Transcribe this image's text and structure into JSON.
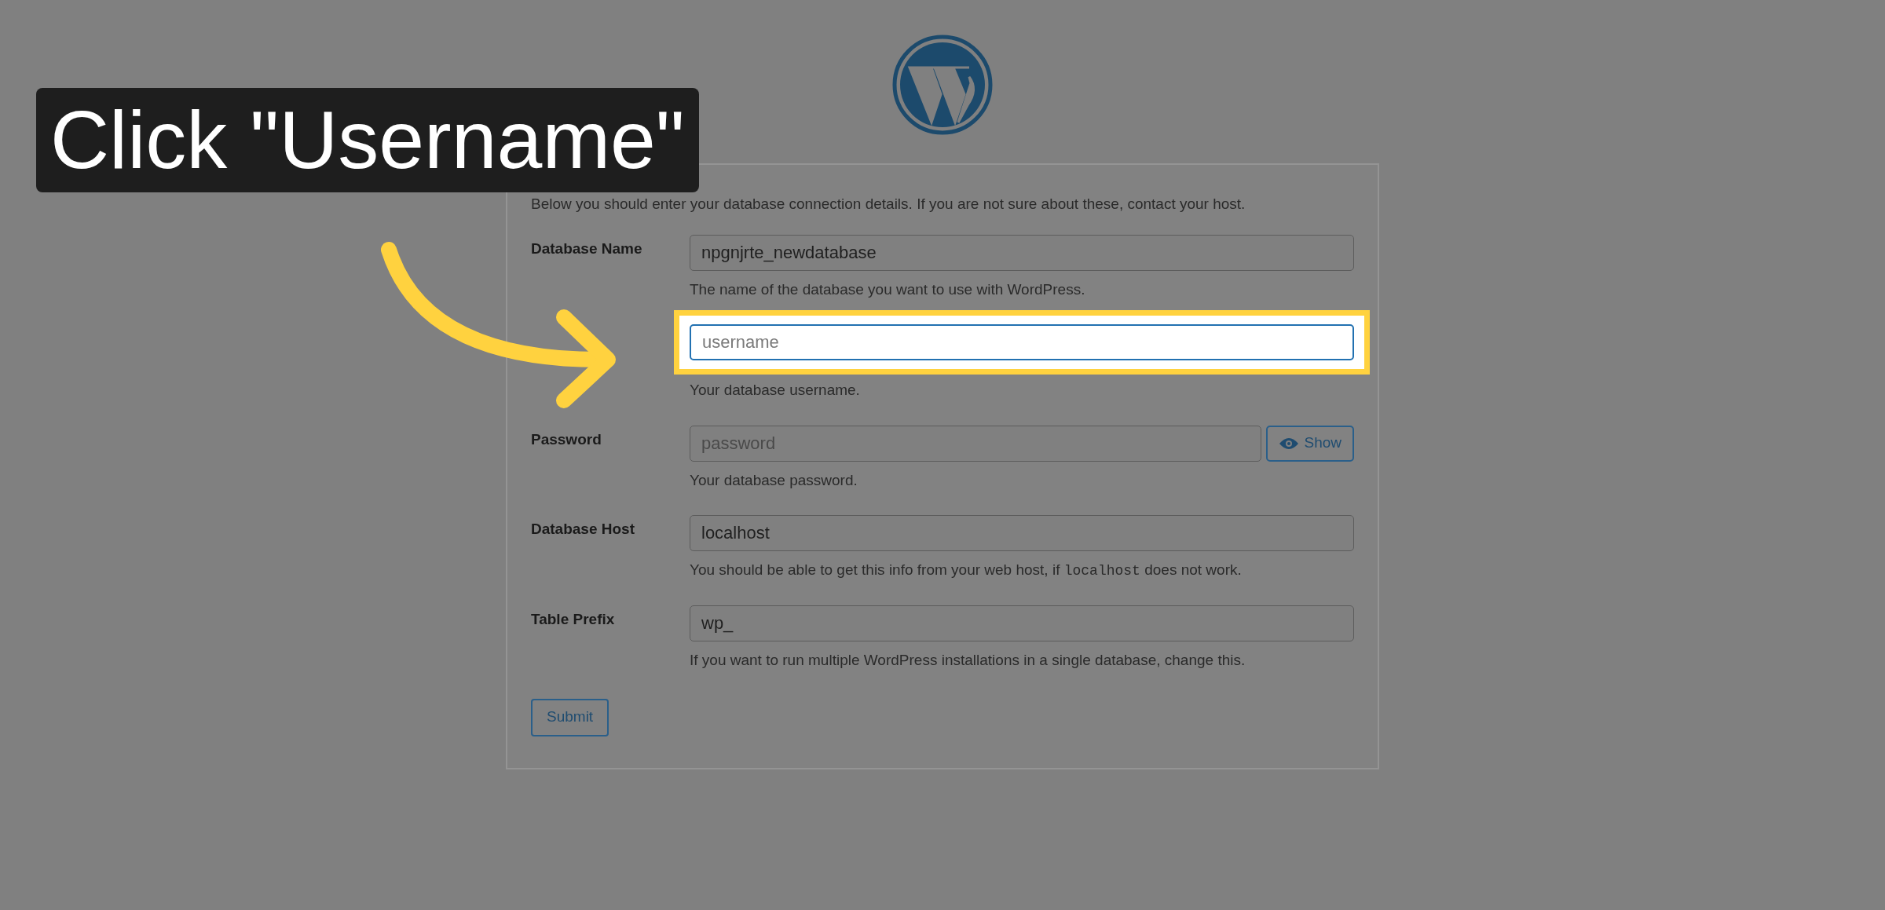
{
  "caption": "Click \"Username\"",
  "intro": "Below you should enter your database connection details. If you are not sure about these, contact your host.",
  "fields": [
    {
      "label": "Database Name",
      "value": "npgnjrte_newdatabase",
      "focused": false,
      "help": [
        {
          "text": "The name of the database you want to use with WordPress."
        }
      ]
    },
    {
      "placeholder": "username",
      "focused": true,
      "help": [
        {
          "text": "Your database username."
        }
      ]
    },
    {
      "label": "Password",
      "placeholder": "password",
      "focused": false,
      "button": "Show",
      "help": [
        {
          "text": "Your database password."
        }
      ]
    },
    {
      "label": "Database Host",
      "value": "localhost",
      "focused": false,
      "help": [
        {
          "text": "You should be able to get this info from your web host, if "
        },
        {
          "text": "localhost",
          "kind": "code"
        },
        {
          "text": " does not work."
        }
      ]
    },
    {
      "label": "Table Prefix",
      "value": "wp_",
      "focused": false,
      "help": [
        {
          "text": "If you want to run multiple WordPress installations in a single database, change this."
        }
      ]
    }
  ],
  "submit": "Submit"
}
